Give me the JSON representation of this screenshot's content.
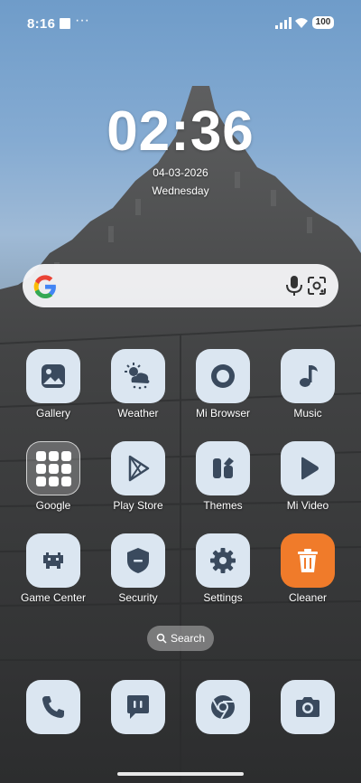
{
  "status_bar": {
    "time": "8:16",
    "dots": "···",
    "battery": "100"
  },
  "clock": {
    "time": "02:36",
    "date": "04-03-2026",
    "weekday": "Wednesday"
  },
  "search": {
    "placeholder": ""
  },
  "apps": [
    {
      "label": "Gallery"
    },
    {
      "label": "Weather"
    },
    {
      "label": "Mi Browser"
    },
    {
      "label": "Music"
    },
    {
      "label": "Google"
    },
    {
      "label": "Play Store"
    },
    {
      "label": "Themes"
    },
    {
      "label": "Mi Video"
    },
    {
      "label": "Game Center"
    },
    {
      "label": "Security"
    },
    {
      "label": "Settings"
    },
    {
      "label": "Cleaner"
    }
  ],
  "search_pill": {
    "label": "Search"
  },
  "dock": [
    "phone-icon",
    "messages-icon",
    "chrome-icon",
    "camera-icon"
  ],
  "colors": {
    "icon_bg": "#dbe6f1",
    "cleaner_bg": "#f07b2a",
    "icon_fg": "#3a4a5e"
  }
}
